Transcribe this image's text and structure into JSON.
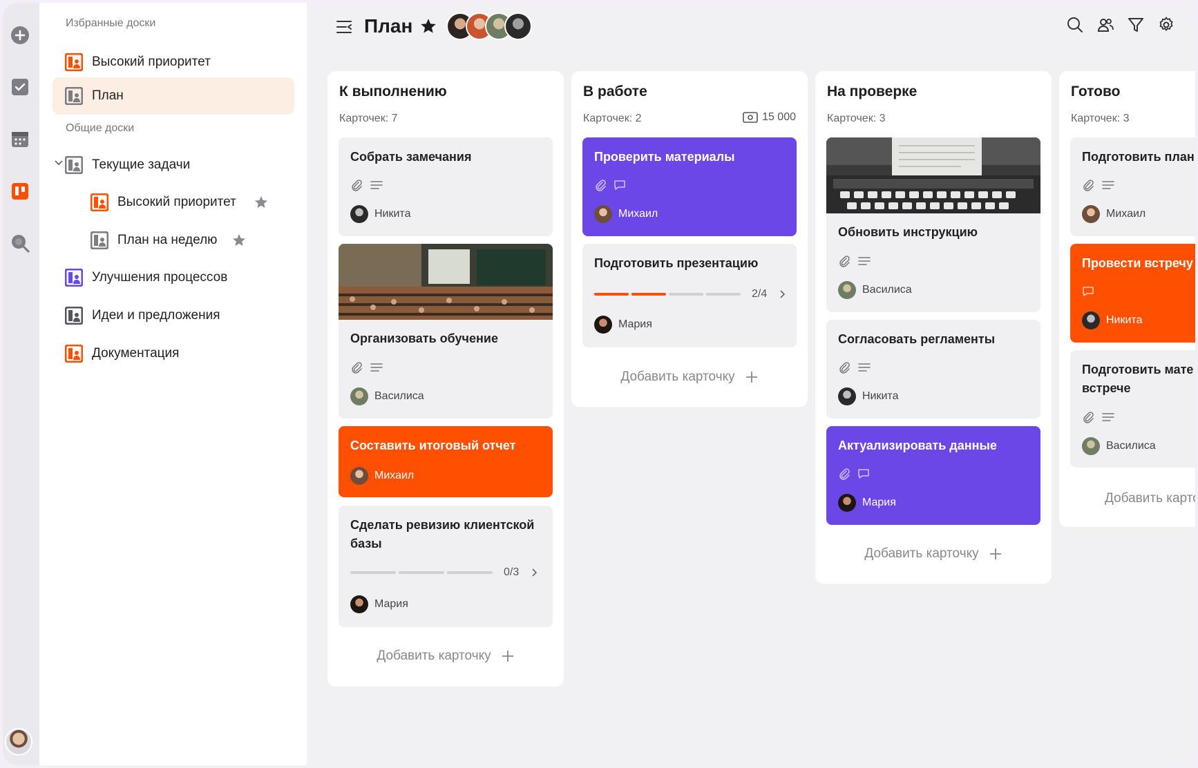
{
  "sidebar": {
    "favorites_label": "Избранные доски",
    "shared_label": "Общие доски",
    "favorites": [
      {
        "label": "Высокий приоритет",
        "color": "#ff4f00"
      },
      {
        "label": "План",
        "color": "#7d7d85",
        "active": true
      }
    ],
    "shared": [
      {
        "label": "Текущие задачи",
        "color": "#7d7d85",
        "expanded": true
      },
      {
        "label": "Высокий приоритет",
        "color": "#ff4f00",
        "starred": true
      },
      {
        "label": "План на неделю",
        "color": "#7d7d85",
        "starred": true
      },
      {
        "label": "Улучшения процессов",
        "color": "#6c47e8"
      },
      {
        "label": "Идеи и предложения",
        "color": "#555560"
      },
      {
        "label": "Документация",
        "color": "#ff4f00"
      }
    ]
  },
  "header": {
    "title": "План"
  },
  "colors": {
    "accent_orange": "#ff4f00",
    "accent_purple": "#6c47e8",
    "active_bg": "#fdeee3"
  },
  "add_card_label": "Добавить карточку",
  "columns": [
    {
      "title": "К выполнению",
      "count": "Карточек: 7",
      "cards": [
        {
          "title": "Собрать замечания",
          "user": "Никита"
        },
        {
          "title": "Организовать обучение",
          "user": "Василиса"
        },
        {
          "title": "Составить итоговый отчет",
          "user": "Михаил"
        },
        {
          "title_1": "Сделать ревизию клиентской",
          "title_2": "базы",
          "progress": "0/3",
          "user": "Мария"
        }
      ]
    },
    {
      "title": "В работе",
      "count": "Карточек: 2",
      "money": "15 000",
      "cards": [
        {
          "title": "Проверить материалы",
          "user": "Михаил"
        },
        {
          "title": "Подготовить презентацию",
          "progress": "2/4",
          "user": "Мария"
        }
      ]
    },
    {
      "title": "На проверке",
      "count": "Карточек: 3",
      "cards": [
        {
          "title": "Обновить инструкцию",
          "user": "Василиса"
        },
        {
          "title": "Согласовать регламенты",
          "user": "Никита"
        },
        {
          "title": "Актуализировать данные",
          "user": "Мария"
        }
      ]
    },
    {
      "title": "Готово",
      "count": "Карточек: 3",
      "cards": [
        {
          "title": "Подготовить план",
          "user": "Михаил"
        },
        {
          "title": "Провести встречу",
          "user": "Никита"
        },
        {
          "title_1": "Подготовить мате",
          "title_2": "встрече",
          "user": "Василиса"
        }
      ]
    }
  ]
}
